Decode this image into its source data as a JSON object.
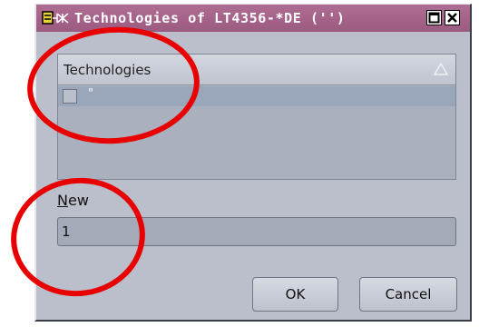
{
  "window": {
    "title": "Technologies of LT4356-*DE ('')"
  },
  "technologies_list": {
    "header": "Technologies",
    "rows": [
      {
        "label": "\"",
        "checked": false
      }
    ]
  },
  "new_field": {
    "label_mnemonic": "N",
    "label_rest": "ew",
    "value": "1"
  },
  "buttons": {
    "ok": "OK",
    "cancel": "Cancel"
  },
  "colors": {
    "titlebar": "#a66287",
    "annotation": "#e80000",
    "dialog_bg": "#babfcb"
  }
}
